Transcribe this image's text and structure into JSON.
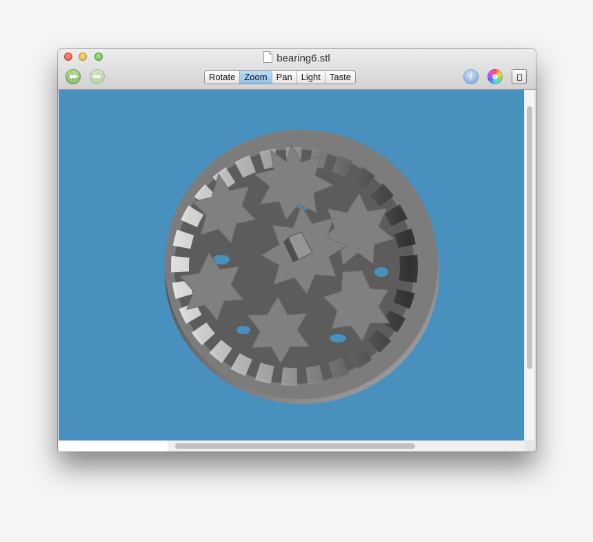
{
  "window": {
    "title": "bearing6.stl",
    "file_icon": "document-icon"
  },
  "toolbar": {
    "back_icon": "back-arrow-icon",
    "forward_icon": "forward-arrow-icon",
    "modes": [
      {
        "label": "Rotate",
        "active": false
      },
      {
        "label": "Zoom",
        "active": true
      },
      {
        "label": "Pan",
        "active": false
      },
      {
        "label": "Light",
        "active": false
      },
      {
        "label": "Taste",
        "active": false
      }
    ],
    "info_glyph": "i",
    "info_icon": "info-icon",
    "color_icon": "color-wheel-icon",
    "panel_icon": "panel-toggle-icon"
  },
  "viewport": {
    "background": "#4890bd",
    "model": "bearing-gear-model"
  }
}
